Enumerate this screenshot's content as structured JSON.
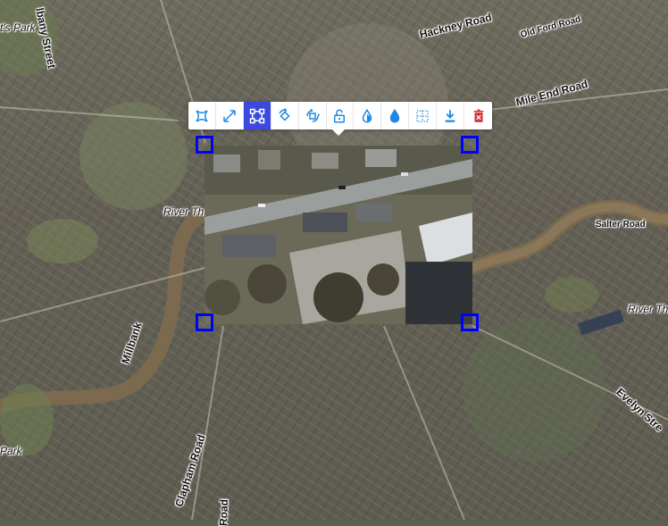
{
  "map": {
    "labels": [
      {
        "key": "regents_park",
        "text": "t's Park"
      },
      {
        "key": "albany_street",
        "text": "lbany Street"
      },
      {
        "key": "hackney_road",
        "text": "Hackney Road"
      },
      {
        "key": "old_ford_road",
        "text": "Old Ford Road"
      },
      {
        "key": "mile_end_road",
        "text": "Mile End Road"
      },
      {
        "key": "river_thames_west",
        "text": "River Tha"
      },
      {
        "key": "river_thames_east",
        "text": "River Tha"
      },
      {
        "key": "salter_road",
        "text": "Salter Road"
      },
      {
        "key": "millbank",
        "text": "Millbank"
      },
      {
        "key": "clapham_road",
        "text": "Clapham Road"
      },
      {
        "key": "road_bottom",
        "text": "Road"
      },
      {
        "key": "evelyn_street",
        "text": "Evelyn Stre"
      },
      {
        "key": "park_left",
        "text": "Park"
      }
    ],
    "colors": {
      "river": "#7d6a4c",
      "handle": "#0000ff",
      "active_tool": "#3b49df"
    }
  },
  "toolbar": {
    "tools": [
      {
        "name": "distort",
        "icon": "distort-icon",
        "active": false,
        "color": "#1e88e5"
      },
      {
        "name": "scale",
        "icon": "scale-icon",
        "active": false,
        "color": "#1e88e5"
      },
      {
        "name": "free-transform",
        "icon": "free-transform-icon",
        "active": true,
        "color": "#ffffff"
      },
      {
        "name": "rotate",
        "icon": "rotate-icon",
        "active": false,
        "color": "#1e88e5"
      },
      {
        "name": "rotate-scale",
        "icon": "rotate-scale-icon",
        "active": false,
        "color": "#1e88e5"
      },
      {
        "name": "lock",
        "icon": "unlock-icon",
        "active": false,
        "color": "#1e88e5"
      },
      {
        "name": "opacity-down",
        "icon": "opacity-down-icon",
        "active": false,
        "color": "#1e88e5"
      },
      {
        "name": "opacity-up",
        "icon": "opacity-up-icon",
        "active": false,
        "color": "#1e88e5"
      },
      {
        "name": "border",
        "icon": "border-icon",
        "active": false,
        "color": "#1e88e5"
      },
      {
        "name": "export",
        "icon": "download-icon",
        "active": false,
        "color": "#1e88e5"
      },
      {
        "name": "delete",
        "icon": "delete-icon",
        "active": false,
        "color": "#d32f2f"
      }
    ]
  }
}
